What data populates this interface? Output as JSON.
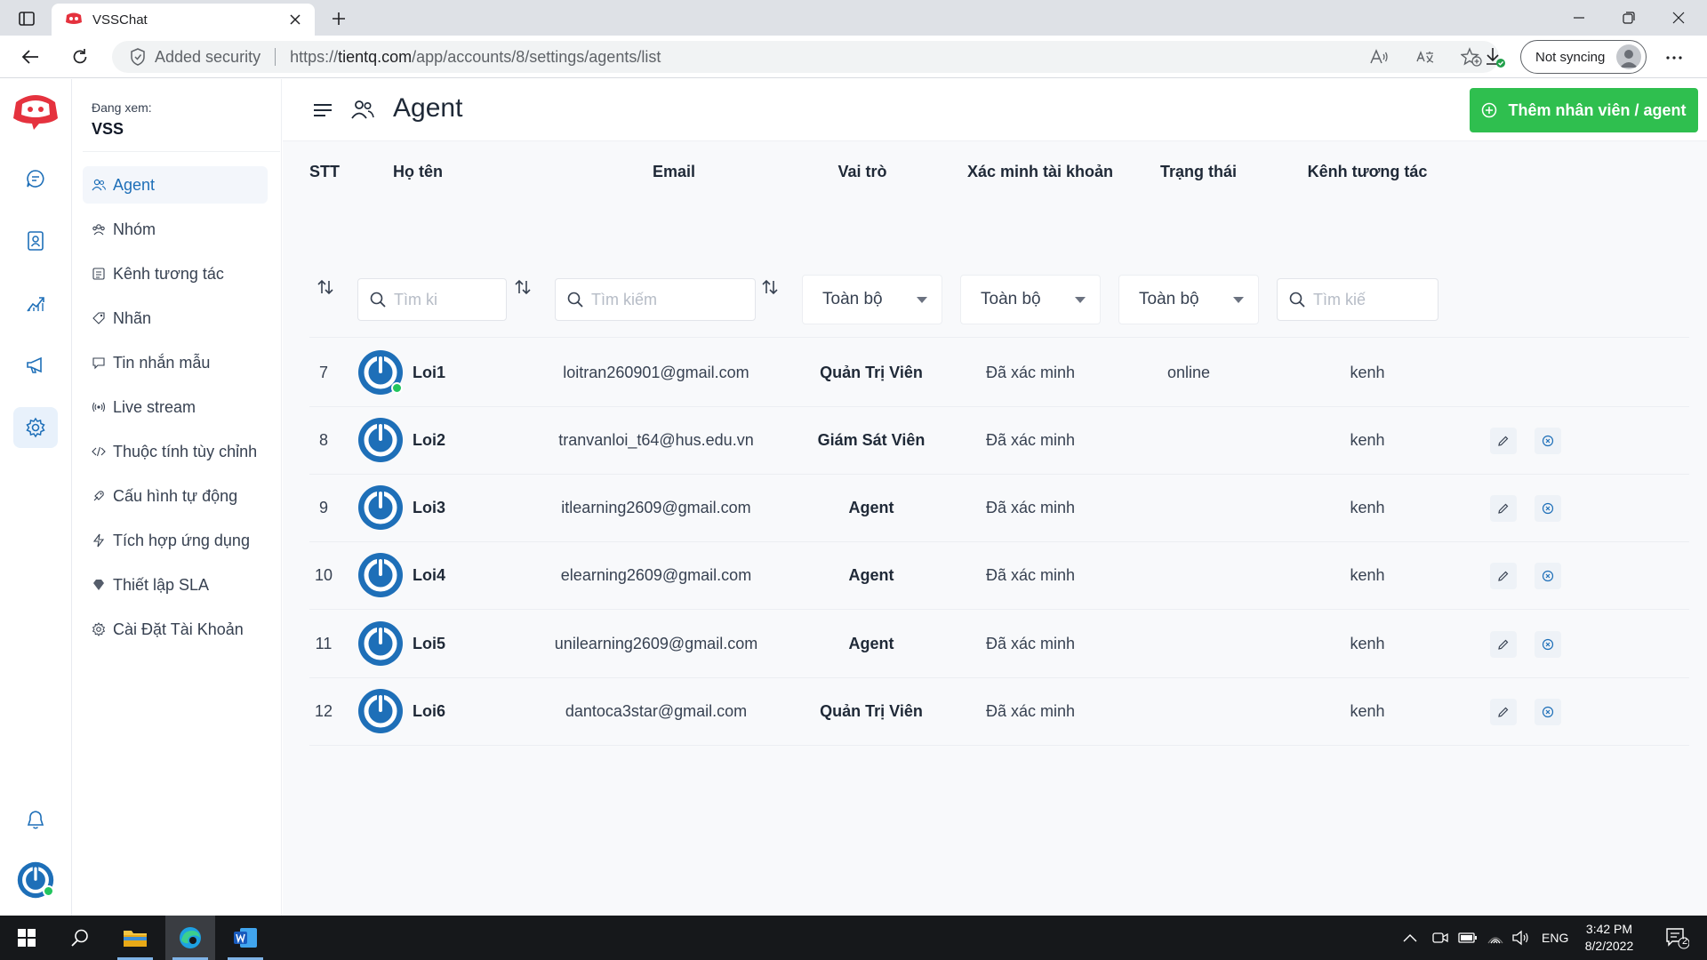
{
  "browser": {
    "tab_title": "VSSChat",
    "security_label": "Added security",
    "url_prefix": "https://",
    "url_domain": "tientq.com",
    "url_path": "/app/accounts/8/settings/agents/list",
    "sync_label": "Not syncing"
  },
  "sidebar": {
    "viewing_label": "Đang xem:",
    "viewing_value": "VSS",
    "items": [
      {
        "label": "Agent",
        "icon": "users-icon"
      },
      {
        "label": "Nhóm",
        "icon": "group-icon"
      },
      {
        "label": "Kênh tương tác",
        "icon": "inbox-icon"
      },
      {
        "label": "Nhãn",
        "icon": "tag-icon"
      },
      {
        "label": "Tin nhắn mẫu",
        "icon": "chat-template-icon"
      },
      {
        "label": "Live stream",
        "icon": "broadcast-icon"
      },
      {
        "label": "Thuộc tính tùy chỉnh",
        "icon": "code-icon"
      },
      {
        "label": "Cấu hình tự động",
        "icon": "automation-icon"
      },
      {
        "label": "Tích hợp ứng dụng",
        "icon": "flash-icon"
      },
      {
        "label": "Thiết lập SLA",
        "icon": "diamond-icon"
      },
      {
        "label": "Cài Đặt Tài Khoản",
        "icon": "settings-icon"
      }
    ]
  },
  "page": {
    "title": "Agent",
    "add_button": "Thêm nhân viên / agent"
  },
  "table": {
    "headers": {
      "stt": "STT",
      "name": "Họ tên",
      "email": "Email",
      "role": "Vai trò",
      "verify": "Xác minh tài khoản",
      "status": "Trạng thái",
      "channel": "Kênh tương tác"
    },
    "filters": {
      "name_placeholder": "Tìm ki",
      "email_placeholder": "Tìm kiếm",
      "role_value": "Toàn bộ",
      "verify_value": "Toàn bộ",
      "status_value": "Toàn bộ",
      "channel_placeholder": "Tìm kiế"
    },
    "rows": [
      {
        "stt": "7",
        "name": "Loi1",
        "email": "loitran260901@gmail.com",
        "role": "Quản Trị Viên",
        "verify": "Đã xác minh",
        "status": "online",
        "channel": "kenh"
      },
      {
        "stt": "8",
        "name": "Loi2",
        "email": "tranvanloi_t64@hus.edu.vn",
        "role": "Giám Sát Viên",
        "verify": "Đã xác minh",
        "status": "",
        "channel": "kenh"
      },
      {
        "stt": "9",
        "name": "Loi3",
        "email": "itlearning2609@gmail.com",
        "role": "Agent",
        "verify": "Đã xác minh",
        "status": "",
        "channel": "kenh"
      },
      {
        "stt": "10",
        "name": "Loi4",
        "email": "elearning2609@gmail.com",
        "role": "Agent",
        "verify": "Đã xác minh",
        "status": "",
        "channel": "kenh"
      },
      {
        "stt": "11",
        "name": "Loi5",
        "email": "unilearning2609@gmail.com",
        "role": "Agent",
        "verify": "Đã xác minh",
        "status": "",
        "channel": "kenh"
      },
      {
        "stt": "12",
        "name": "Loi6",
        "email": "dantoca3star@gmail.com",
        "role": "Quản Trị Viên",
        "verify": "Đã xác minh",
        "status": "",
        "channel": "kenh"
      }
    ]
  },
  "taskbar": {
    "language": "ENG",
    "time": "3:42 PM",
    "date": "8/2/2022",
    "notification_count": "2"
  },
  "colors": {
    "accent": "#1e6fb8",
    "add_button": "#2fbf4f",
    "online": "#22c55e",
    "logo_red": "#e5323e"
  }
}
